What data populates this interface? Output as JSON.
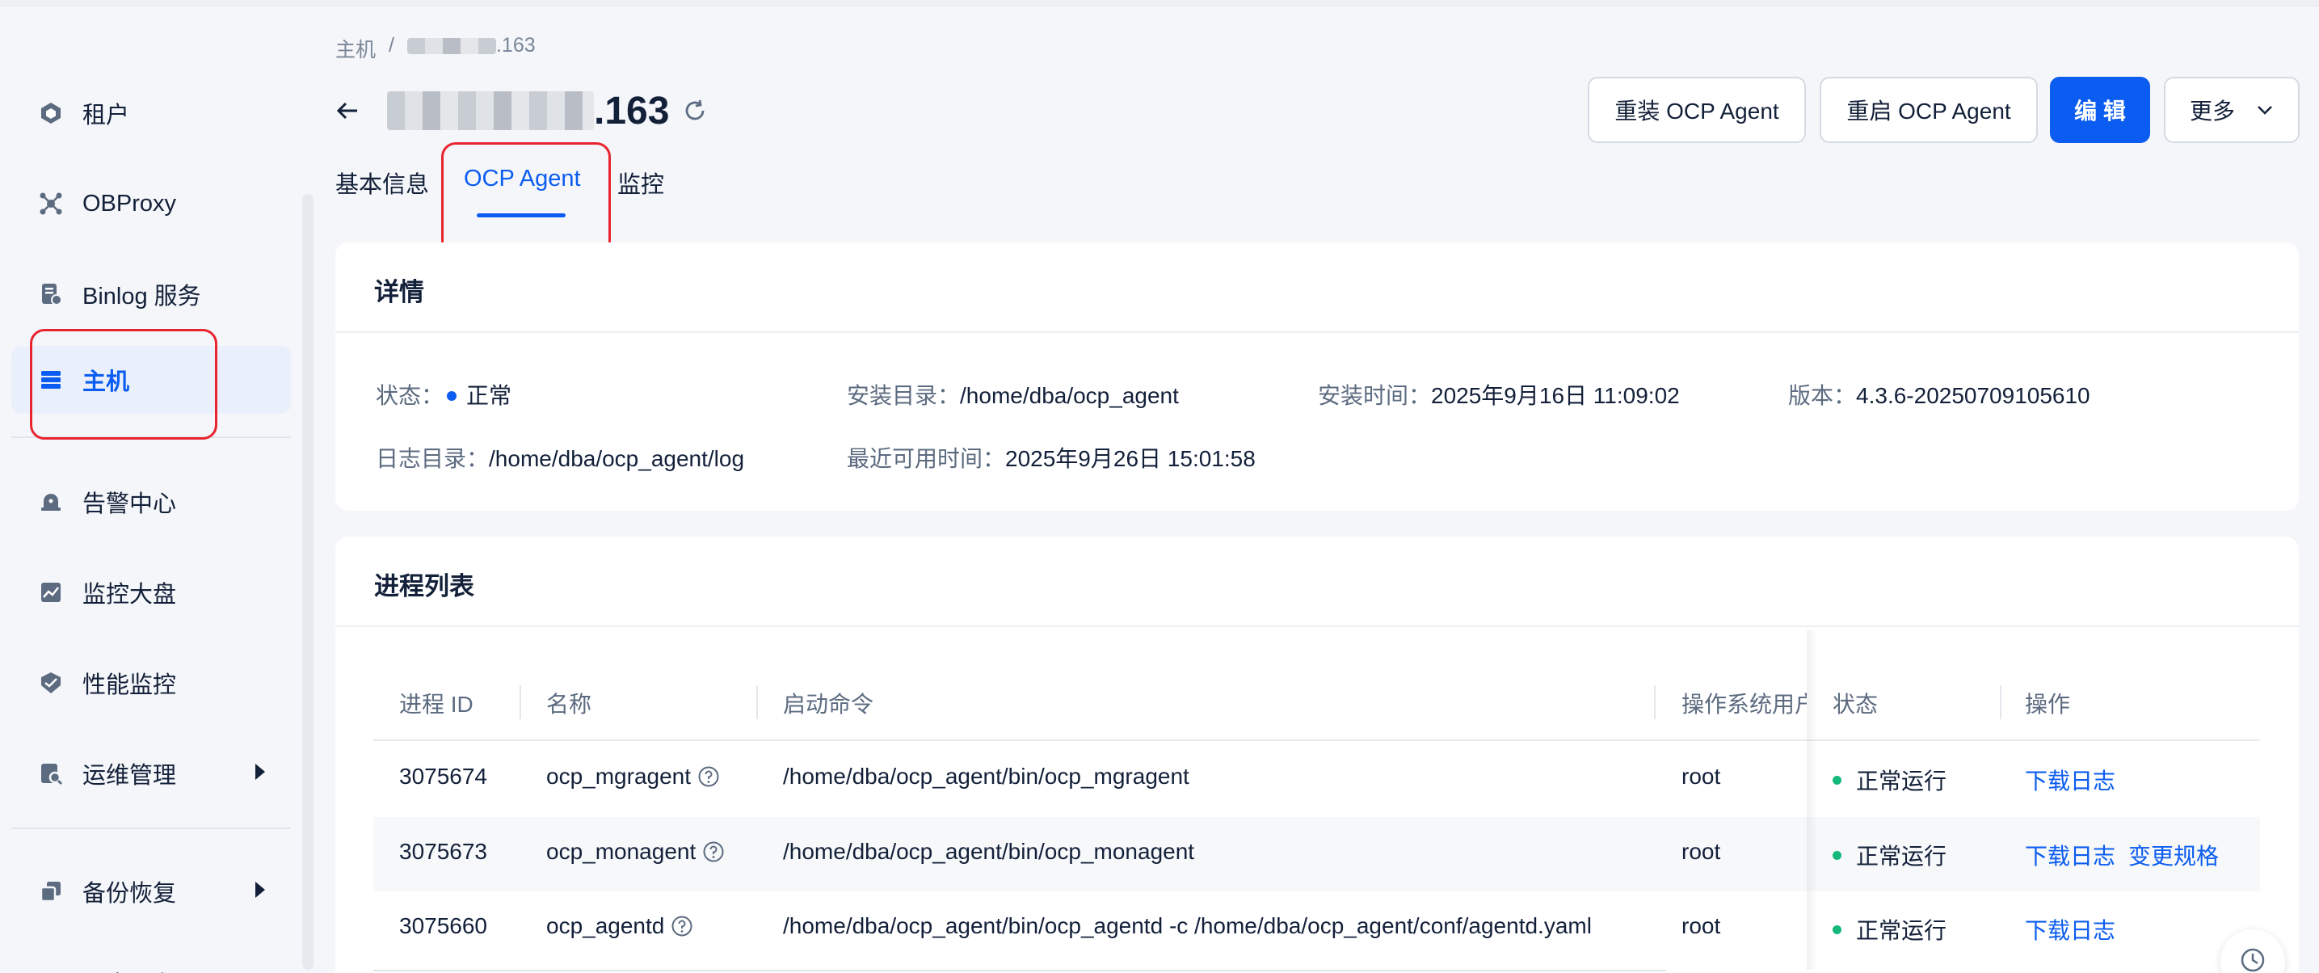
{
  "sidebar": {
    "items": [
      {
        "label": "租户",
        "icon": "tenant-icon"
      },
      {
        "label": "OBProxy",
        "icon": "obproxy-icon"
      },
      {
        "label": "Binlog 服务",
        "icon": "binlog-icon"
      },
      {
        "label": "主机",
        "icon": "host-icon",
        "active": true
      },
      {
        "label": "告警中心",
        "icon": "alarm-icon"
      },
      {
        "label": "监控大盘",
        "icon": "dashboard-icon"
      },
      {
        "label": "性能监控",
        "icon": "performance-icon"
      },
      {
        "label": "运维管理",
        "icon": "ops-icon",
        "expandable": true
      },
      {
        "label": "备份恢复",
        "icon": "backup-icon",
        "expandable": true
      },
      {
        "label": "日志服务",
        "icon": "log-icon"
      }
    ]
  },
  "breadcrumb": {
    "root": "主机",
    "separator": "/",
    "current_suffix": ".163"
  },
  "header": {
    "title_suffix": ".163"
  },
  "actions": {
    "reinstall": "重装 OCP Agent",
    "restart": "重启 OCP Agent",
    "edit": "编 辑",
    "more": "更多"
  },
  "tabs": [
    {
      "label": "基本信息"
    },
    {
      "label": "OCP Agent",
      "active": true
    },
    {
      "label": "监控"
    }
  ],
  "details": {
    "title": "详情",
    "status_key": "状态：",
    "status_value": "正常",
    "install_dir_key": "安装目录：",
    "install_dir_value": "/home/dba/ocp_agent",
    "install_time_key": "安装时间：",
    "install_time_value": "2025年9月16日 11:09:02",
    "version_key": "版本：",
    "version_value": "4.3.6-20250709105610",
    "log_dir_key": "日志目录：",
    "log_dir_value": "/home/dba/ocp_agent/log",
    "last_available_key": "最近可用时间：",
    "last_available_value": "2025年9月26日 15:01:58"
  },
  "processes": {
    "title": "进程列表",
    "columns": [
      "进程 ID",
      "名称",
      "启动命令",
      "操作系统用户",
      "状态",
      "操作"
    ],
    "rows": [
      {
        "pid": "3075674",
        "name": "ocp_mgragent",
        "cmd": "/home/dba/ocp_agent/bin/ocp_mgragent",
        "user": "root",
        "status": "正常运行",
        "op1": "下载日志",
        "op2": ""
      },
      {
        "pid": "3075673",
        "name": "ocp_monagent",
        "cmd": "/home/dba/ocp_agent/bin/ocp_monagent",
        "user": "root",
        "status": "正常运行",
        "op1": "下载日志",
        "op2": "变更规格"
      },
      {
        "pid": "3075660",
        "name": "ocp_agentd",
        "cmd": "/home/dba/ocp_agent/bin/ocp_agentd -c /home/dba/ocp_agent/conf/agentd.yaml",
        "user": "root",
        "status": "正常运行",
        "op1": "下载日志",
        "op2": ""
      }
    ]
  },
  "colors": {
    "accent": "#0b5cf0",
    "success": "#14b87a",
    "highlight": "#e8242f"
  }
}
